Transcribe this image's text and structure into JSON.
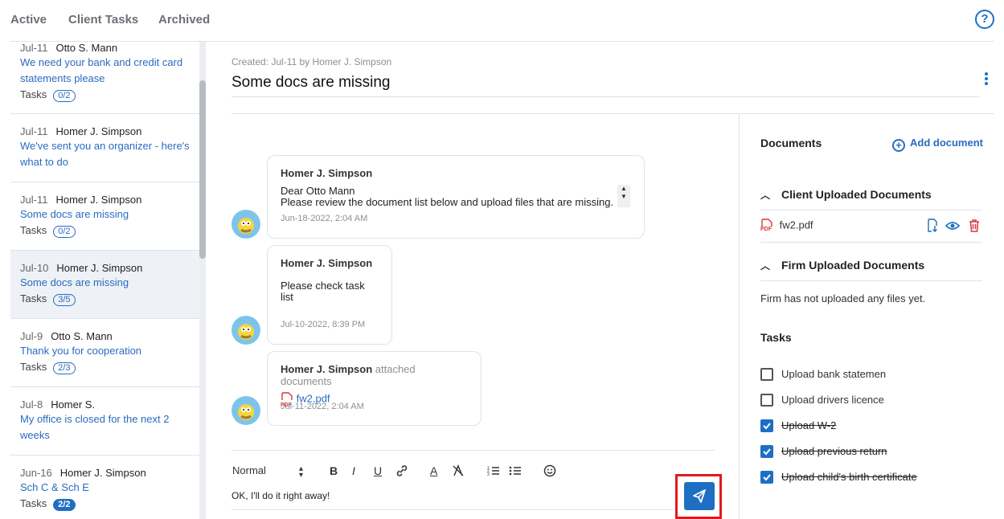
{
  "nav": {
    "tabs": [
      "Active",
      "Client Tasks",
      "Archived"
    ],
    "help": "?"
  },
  "threads": [
    {
      "date": "Jul-11",
      "author": "Otto S. Mann",
      "title": "We need your bank and credit card statements please",
      "tasks_label": "Tasks",
      "tasks": "0/2"
    },
    {
      "date": "Jul-11",
      "author": "Homer J. Simpson",
      "title": "We've sent you an organizer - here's what to do",
      "tasks_label": "",
      "tasks": ""
    },
    {
      "date": "Jul-11",
      "author": "Homer J. Simpson",
      "title": "Some docs are missing",
      "tasks_label": "Tasks",
      "tasks": "0/2"
    },
    {
      "date": "Jul-10",
      "author": "Homer J. Simpson",
      "title": "Some docs are missing",
      "tasks_label": "Tasks",
      "tasks": "3/5"
    },
    {
      "date": "Jul-9",
      "author": "Otto S. Mann",
      "title": "Thank you for cooperation",
      "tasks_label": "Tasks",
      "tasks": "2/3"
    },
    {
      "date": "Jul-8",
      "author": "Homer S.",
      "title": "My office is closed for the next 2 weeks",
      "tasks_label": "",
      "tasks": ""
    },
    {
      "date": "Jun-16",
      "author": "Homer J. Simpson",
      "title": "Sch C & Sch E",
      "tasks_label": "Tasks",
      "tasks": "2/2"
    }
  ],
  "main": {
    "created": "Created: Jul-11 by Homer J. Simpson",
    "title": "Some docs are missing"
  },
  "messages": [
    {
      "author": "Homer J. Simpson",
      "line1": "Dear Otto Mann",
      "line2": "Please review the document list below and upload files that are missing.",
      "time": "Jun-18-2022, 2:04 AM"
    },
    {
      "author": "Homer J. Simpson",
      "line1": "Please check task list",
      "time": "Jul-10-2022, 8:39 PM"
    },
    {
      "author": "Homer J. Simpson",
      "extra": "attached documents",
      "file": "fw2.pdf",
      "pdf_tag": "PDF",
      "time": "Jul-11-2022, 2:04 AM"
    }
  ],
  "composer": {
    "format": "Normal",
    "bold": "B",
    "italic": "I",
    "underline": "U",
    "color": "A",
    "text": "OK, I'll do it right away!"
  },
  "documents": {
    "heading": "Documents",
    "add": "Add document",
    "client_section": "Client Uploaded Documents",
    "client_file": "fw2.pdf",
    "pdf_tag": "PDF",
    "firm_section": "Firm Uploaded Documents",
    "firm_empty": "Firm has not uploaded any files yet."
  },
  "tasks": {
    "heading": "Tasks",
    "items": [
      {
        "label": "Upload bank statemen",
        "done": false
      },
      {
        "label": "Upload drivers licence",
        "done": false
      },
      {
        "label": "Upload W-2",
        "done": true
      },
      {
        "label": "Upload previous return",
        "done": true
      },
      {
        "label": "Upload child's birth certificate",
        "done": true
      }
    ]
  },
  "colors": {
    "accent": "#1d6fc4",
    "highlight": "#e01b1b",
    "pdf": "#d9363e"
  }
}
